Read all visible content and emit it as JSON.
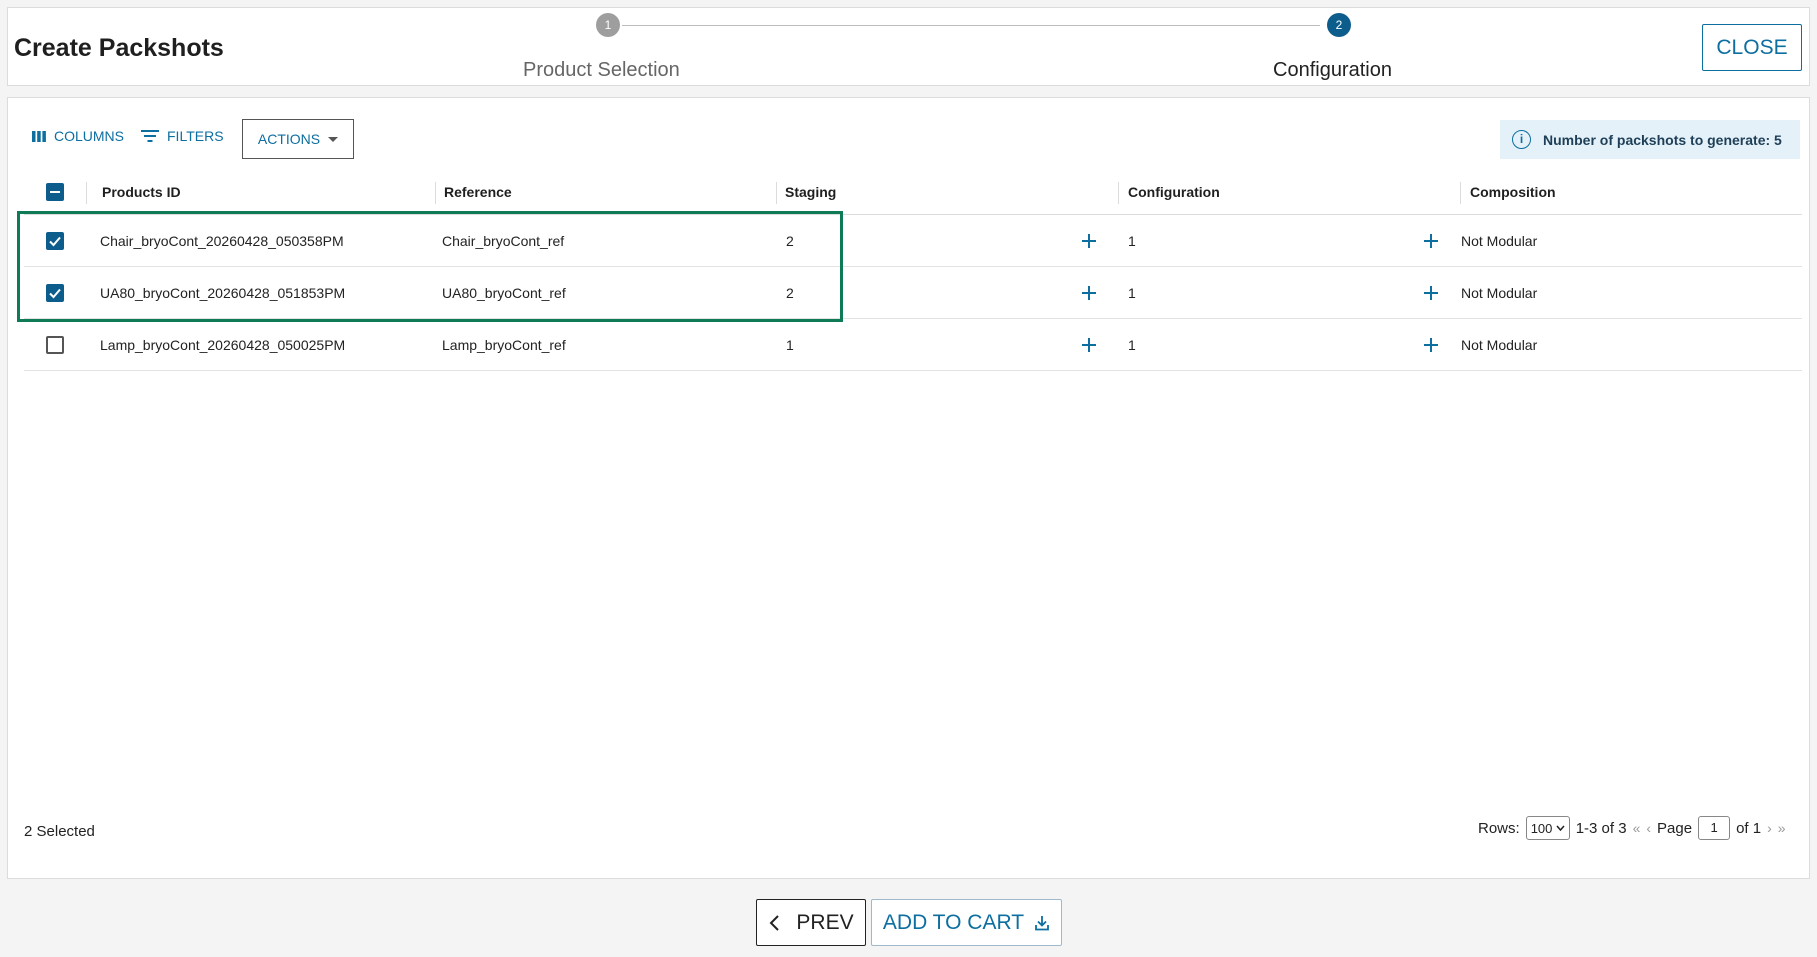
{
  "header": {
    "title": "Create Packshots",
    "steps": [
      {
        "number": "1",
        "label": "Product Selection",
        "status": "done"
      },
      {
        "number": "2",
        "label": "Configuration",
        "status": "active"
      }
    ],
    "close_label": "CLOSE"
  },
  "toolbar": {
    "columns_label": "COLUMNS",
    "filters_label": "FILTERS",
    "actions_label": "ACTIONS",
    "info_text": "Number of packshots to generate: 5"
  },
  "table": {
    "headers": [
      "Products ID",
      "Reference",
      "Staging",
      "Configuration",
      "Composition"
    ],
    "rows": [
      {
        "checked": true,
        "product_id": "Chair_bryoCont_20260428_050358PM",
        "reference": "Chair_bryoCont_ref",
        "staging": "2",
        "configuration": "1",
        "composition": "Not Modular"
      },
      {
        "checked": true,
        "product_id": "UA80_bryoCont_20260428_051853PM",
        "reference": "UA80_bryoCont_ref",
        "staging": "2",
        "configuration": "1",
        "composition": "Not Modular"
      },
      {
        "checked": false,
        "product_id": "Lamp_bryoCont_20260428_050025PM",
        "reference": "Lamp_bryoCont_ref",
        "staging": "1",
        "configuration": "1",
        "composition": "Not Modular"
      }
    ]
  },
  "footer": {
    "selected_text": "2 Selected",
    "rows_label": "Rows:",
    "rows_value": "100",
    "range_text": "1-3 of 3",
    "page_label": "Page",
    "page_value": "1",
    "page_of": "of 1"
  },
  "actions": {
    "prev_label": "PREV",
    "add_to_cart_label": "ADD TO CART"
  },
  "colors": {
    "accent": "#0d6ea0",
    "active_step": "#0d5d8c",
    "highlight_border": "#0e7a56"
  }
}
